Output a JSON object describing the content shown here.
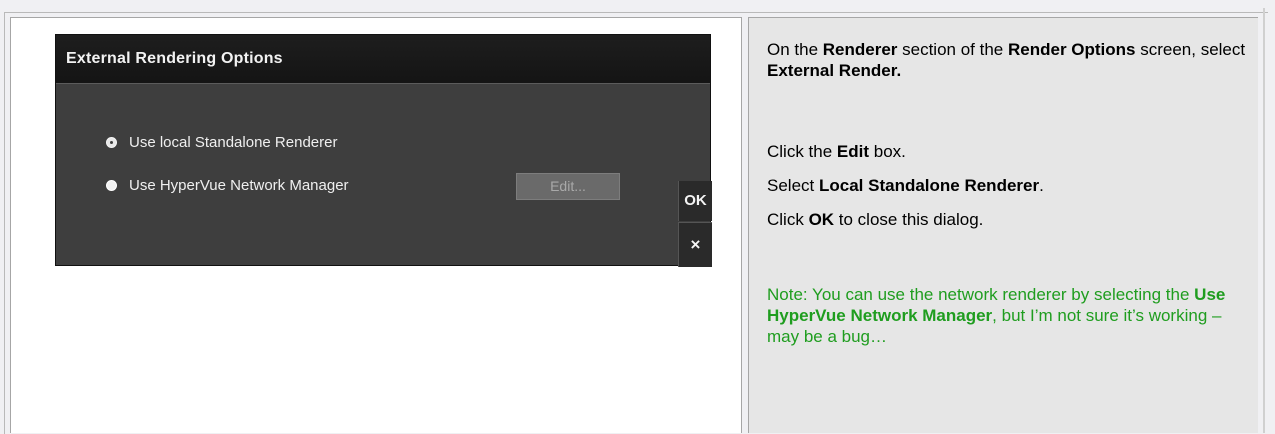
{
  "dialog": {
    "title": "External Rendering Options",
    "option_local": "Use local Standalone Renderer",
    "option_network": "Use HyperVue Network Manager",
    "edit_label": "Edit...",
    "ok_label": "OK",
    "close_glyph": "×",
    "close_icon": "close-icon",
    "selected_option": "Use local Standalone Renderer"
  },
  "instructions": {
    "step1": {
      "t1": "On the ",
      "b1": "Renderer",
      "t2": " section of the ",
      "b2": "Render Options",
      "t3": " screen, select ",
      "b3": "External Render."
    },
    "step2": {
      "t1": "Click the ",
      "b1": "Edit",
      "t2": " box."
    },
    "step3": {
      "t1": "Select ",
      "b1": "Local Standalone Renderer",
      "t2": "."
    },
    "step4": {
      "t1": "Click ",
      "b1": "OK",
      "t2": " to close this dialog."
    }
  },
  "note": {
    "t1": "Note:  You can use the network renderer by selecting the ",
    "b1": "Use HyperVue Network Manager",
    "t2": ", but I’m not sure it’s working – may be a bug…"
  },
  "colors": {
    "note_text": "#1f9d1f",
    "dialog_bg": "#3e3e3e",
    "right_cell_bg": "#e6e6e6"
  }
}
